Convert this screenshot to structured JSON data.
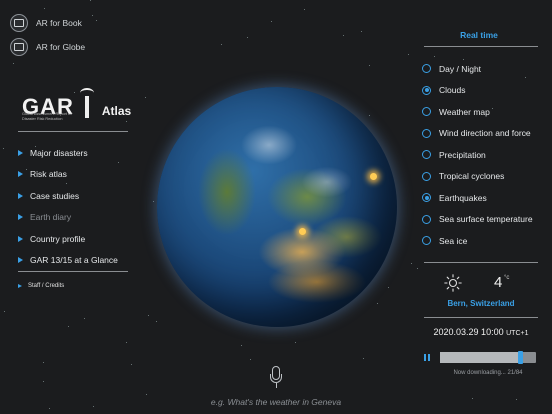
{
  "top_buttons": [
    {
      "label": "AR for Book",
      "icon": "ar-book-icon"
    },
    {
      "label": "AR for Globe",
      "icon": "ar-globe-icon"
    }
  ],
  "logo": {
    "mark": "GAR",
    "subtitle": "Global Assessment Report on Disaster Risk Reduction",
    "app_name": "Atlas"
  },
  "menu": {
    "items": [
      {
        "label": "Major disasters",
        "enabled": true
      },
      {
        "label": "Risk atlas",
        "enabled": true
      },
      {
        "label": "Case studies",
        "enabled": true
      },
      {
        "label": "Earth diary",
        "enabled": false
      },
      {
        "label": "Country profile",
        "enabled": true
      },
      {
        "label": "GAR 13/15 at a Glance",
        "enabled": true
      }
    ],
    "credits": "Staff / Credits"
  },
  "realtime": {
    "title": "Real time",
    "layers": [
      {
        "label": "Day / Night",
        "selected": false
      },
      {
        "label": "Clouds",
        "selected": true
      },
      {
        "label": "Weather map",
        "selected": false
      },
      {
        "label": "Wind direction and force",
        "selected": false
      },
      {
        "label": "Precipitation",
        "selected": false
      },
      {
        "label": "Tropical cyclones",
        "selected": false
      },
      {
        "label": "Earthquakes",
        "selected": true
      },
      {
        "label": "Sea surface temperature",
        "selected": false
      },
      {
        "label": "Sea ice",
        "selected": false
      }
    ]
  },
  "weather": {
    "icon": "sun-icon",
    "temperature": "4",
    "unit": "°c",
    "location": "Bern, Switzerland"
  },
  "datetime": {
    "date_time": "2020.03.29 10:00",
    "timezone": "UTC+1"
  },
  "timeline": {
    "progress": 0.84,
    "status": "Now downloading... 21/84"
  },
  "voice": {
    "icon": "microphone-icon",
    "placeholder": "e.g. What's the weather in Geneva"
  },
  "colors": {
    "accent": "#3aa0e6",
    "background": "#1b1c1e"
  }
}
